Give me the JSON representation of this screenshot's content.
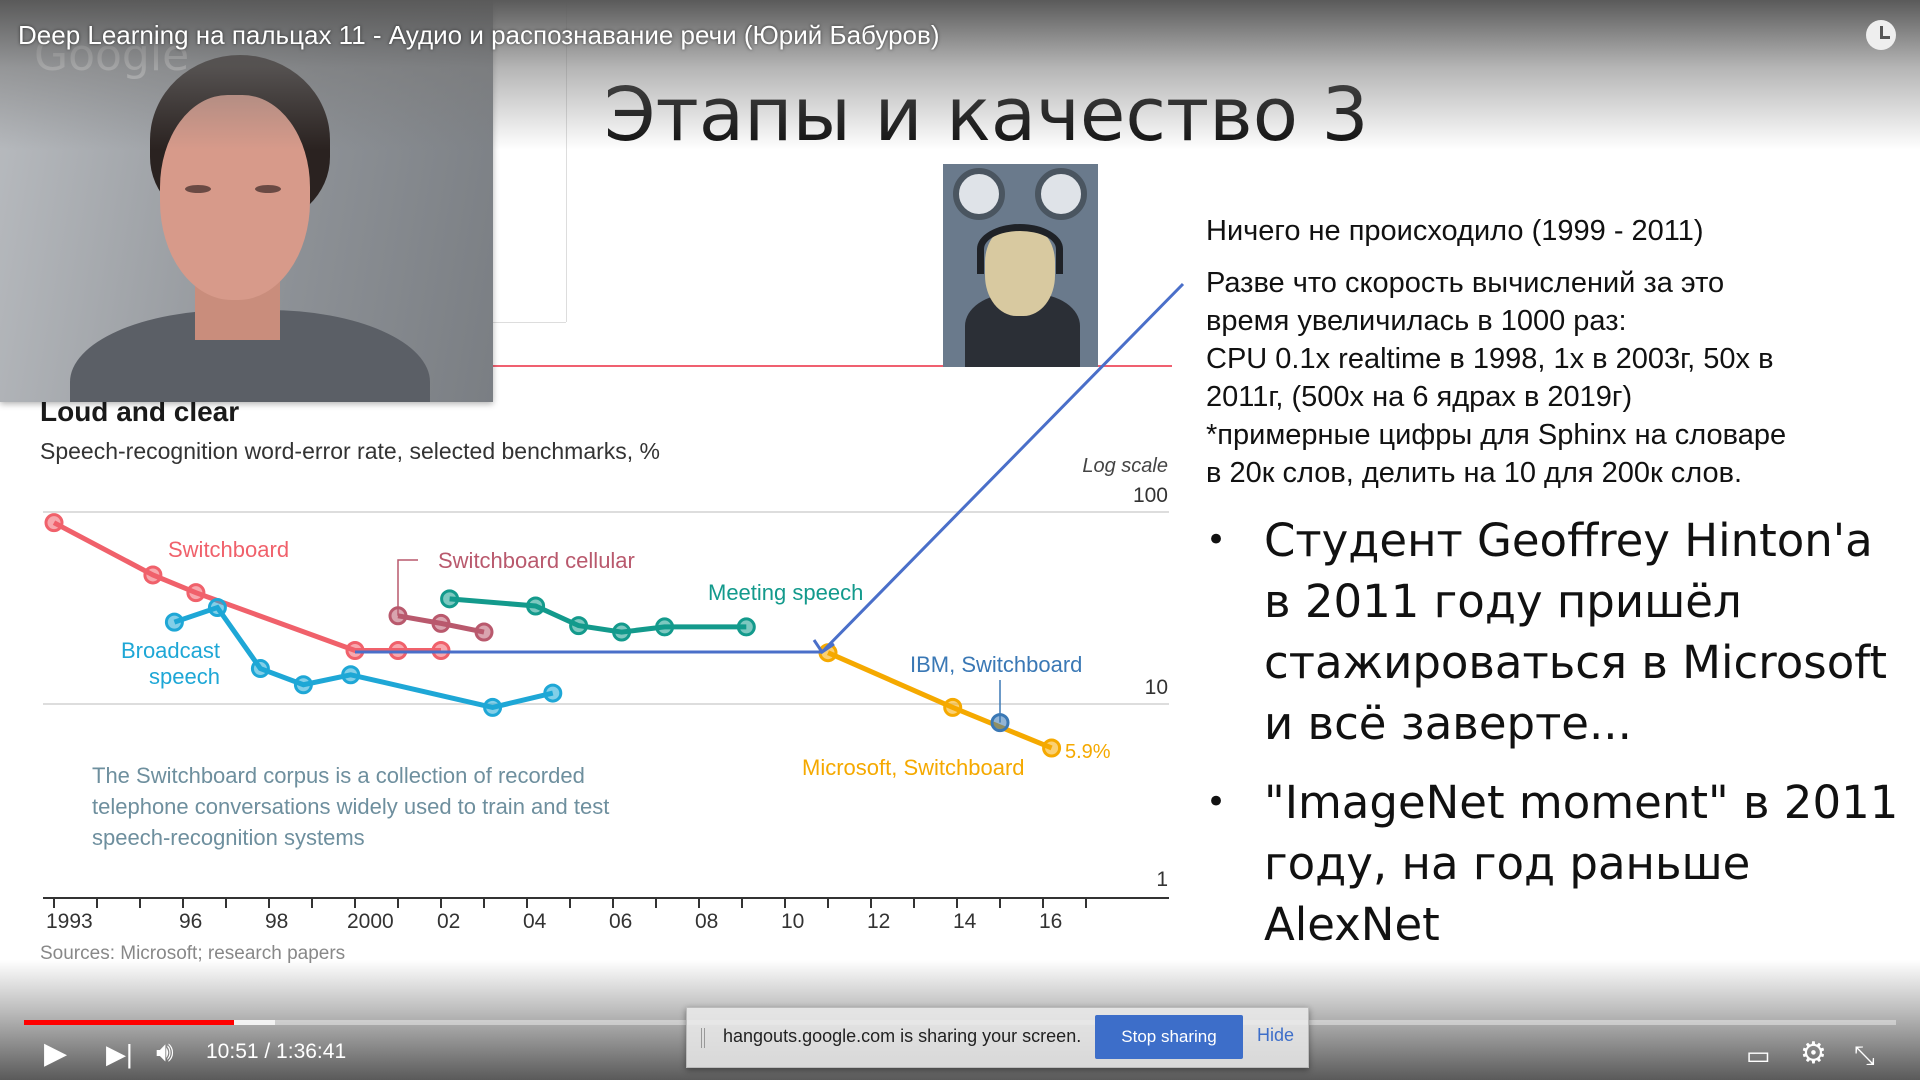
{
  "player": {
    "video_title": "Deep Learning на пальцах 11 - Аудио и распознавание речи (Юрий Бабуров)",
    "time": "10:51 / 1:36:41",
    "progress_percent": 11.2,
    "buffered_percent": 13.4
  },
  "webcam": {
    "watermark": "Google"
  },
  "slide": {
    "title": "Этапы и качество 3",
    "lead": "Ничего не происходило (1999 - 2011)",
    "paragraph": [
      "Разве что скорость вычислений за это",
      "время увеличилась в 1000 раз:",
      "CPU 0.1x realtime в 1998, 1x в 2003г, 50x в",
      "2011г, (500x на 6 ядрах в 2019г)",
      "*примерные цифры для Sphinx на словаре",
      "в 20к слов, делить на 10 для 200к слов."
    ],
    "bullets": [
      "Студент Geoffrey Hinton'а в 2011 году пришёл стажироваться в Microsoft и всё заверте...",
      "\"ImageNet moment\" в 2011 году, на год раньше AlexNet"
    ],
    "bullet_symbol": "•"
  },
  "chart_data": {
    "type": "line",
    "title": "Loud and clear",
    "subtitle": "Speech-recognition word-error rate, selected benchmarks, %",
    "scale_label": "Log scale",
    "ylim": [
      1,
      100
    ],
    "y_ticks": [
      "100",
      "10",
      "1"
    ],
    "x_ticks": [
      [
        "1993",
        1993
      ],
      [
        "96",
        1996
      ],
      [
        "98",
        1998
      ],
      [
        "2000",
        2000
      ],
      [
        "02",
        2002
      ],
      [
        "04",
        2004
      ],
      [
        "06",
        2006
      ],
      [
        "08",
        2008
      ],
      [
        "10",
        2010
      ],
      [
        "12",
        2012
      ],
      [
        "14",
        2014
      ],
      [
        "16",
        2016
      ]
    ],
    "series": [
      {
        "name": "Switchboard",
        "color": "#f0616b",
        "x": [
          1993,
          1995.3,
          1996.3,
          2000,
          2001,
          2002
        ],
        "y": [
          88,
          47,
          38,
          19,
          19,
          19
        ]
      },
      {
        "name": "Switchboard cellular",
        "color": "#b9596d",
        "x": [
          2001,
          2002,
          2003
        ],
        "y": [
          28.8,
          26.3,
          23.7
        ]
      },
      {
        "name": "Broadcast speech",
        "color": "#1ea7d6",
        "x": [
          1995.8,
          1996.8,
          1997.8,
          1998.8,
          1999.9,
          2003.2,
          2004.6
        ],
        "y": [
          26.7,
          31.8,
          15.3,
          12.6,
          14.2,
          9.6,
          11.4
        ]
      },
      {
        "name": "Meeting speech",
        "color": "#139a8c",
        "x": [
          2002.2,
          2004.2,
          2005.2,
          2006.2,
          2007.2,
          2009.1
        ],
        "y": [
          35.3,
          32.4,
          25.6,
          23.7,
          25.2,
          25.2
        ]
      },
      {
        "name": "Microsoft, Switchboard",
        "color": "#f5a900",
        "x": [
          2011,
          2013.9,
          2016.2
        ],
        "y": [
          18.5,
          9.6,
          5.9
        ]
      },
      {
        "name": "IBM, Switchboard",
        "color": "#3a78b5",
        "x": [
          2015
        ],
        "y": [
          8.0
        ]
      }
    ],
    "labels": {
      "switchboard": "Switchboard",
      "cellular": "Switchboard cellular",
      "broadcast_1": "Broadcast",
      "broadcast_2": "speech",
      "meeting": "Meeting speech",
      "ibm": "IBM, Switchboard",
      "microsoft": "Microsoft, Switchboard",
      "last_value": "5.9%"
    },
    "note": "The Switchboard corpus is a collection of recorded telephone conversations widely used to train and test speech-recognition systems",
    "sources": "Sources: Microsoft; research papers",
    "annotation_color": "#4a6fc9"
  },
  "share_bar": {
    "message": "hangouts.google.com is sharing your screen.",
    "stop_label": "Stop sharing",
    "hide_label": "Hide"
  },
  "colors": {
    "progress": "#ff0000",
    "stop_button": "#3d6ec9"
  }
}
